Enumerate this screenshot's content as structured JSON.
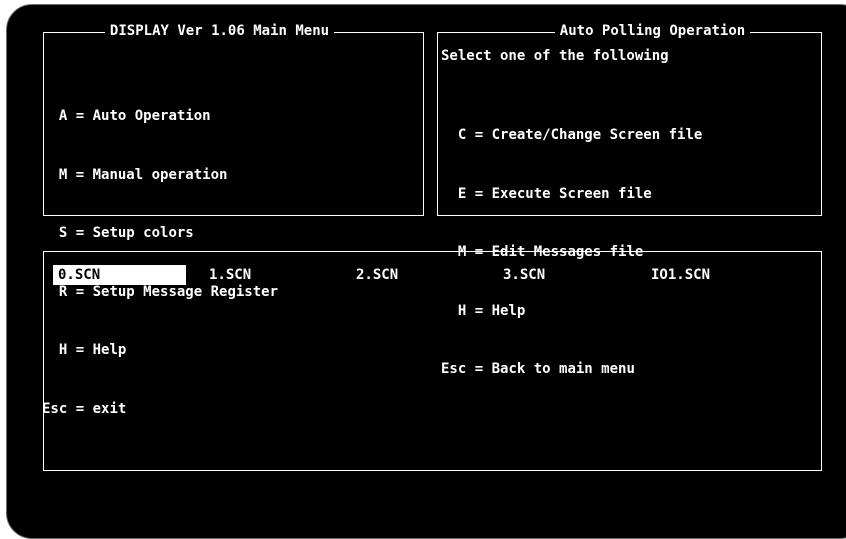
{
  "main_menu": {
    "title": "DISPLAY Ver 1.06 Main Menu",
    "items": [
      {
        "key": "  A",
        "label": "Auto Operation"
      },
      {
        "key": "  M",
        "label": "Manual operation"
      },
      {
        "key": "  S",
        "label": "Setup colors"
      },
      {
        "key": "  R",
        "label": "Setup Message Register"
      },
      {
        "key": "  H",
        "label": "Help"
      },
      {
        "key": "Esc",
        "label": "exit"
      }
    ]
  },
  "polling": {
    "title": "Auto Polling Operation",
    "instruction": "Select one of the following",
    "items": [
      {
        "key": "  C",
        "label": "Create/Change Screen file"
      },
      {
        "key": "  E",
        "label": "Execute Screen file"
      },
      {
        "key": "  M",
        "label": "Edit Messages file"
      },
      {
        "key": "  H",
        "label": "Help"
      },
      {
        "key": "Esc",
        "label": "Back to main menu"
      }
    ]
  },
  "files": {
    "selected_index": 0,
    "items": [
      "0.SCN",
      "1.SCN",
      "2.SCN",
      "3.SCN",
      "IO1.SCN"
    ]
  },
  "colors": {
    "background": "#000000",
    "foreground": "#ffffff",
    "bezel": "#ffffff"
  }
}
